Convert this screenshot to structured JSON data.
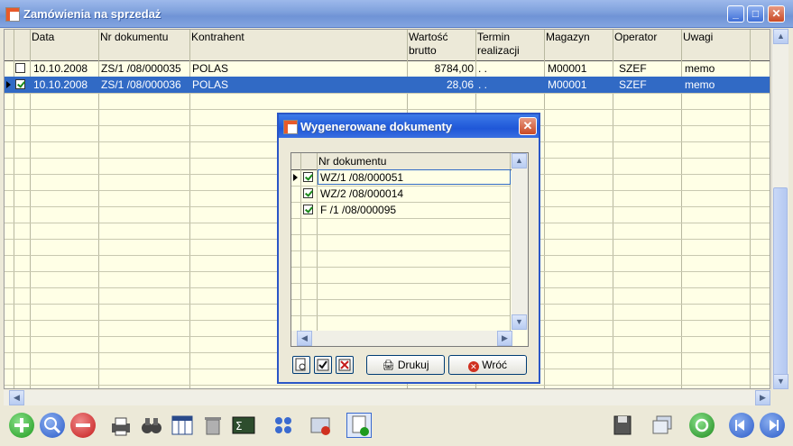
{
  "window": {
    "title": "Zamówienia na sprzedaż",
    "minimize": "_",
    "maximize": "□",
    "close": "✕"
  },
  "columns": {
    "data": "Data",
    "nr_dokumentu": "Nr dokumentu",
    "kontrahent": "Kontrahent",
    "wartosc_1": "Wartość",
    "wartosc_2": "brutto",
    "termin_1": "Termin",
    "termin_2": "realizacji",
    "magazyn": "Magazyn",
    "operator": "Operator",
    "uwagi": "Uwagi"
  },
  "rows": [
    {
      "checked": false,
      "selected": false,
      "data": "10.10.2008",
      "nr": "ZS/1  /08/000035",
      "kontrahent": "POLAS",
      "wartosc": "8784,00",
      "termin": ". .",
      "magazyn": "M00001",
      "operator": "SZEF",
      "uwagi": "memo"
    },
    {
      "checked": true,
      "selected": true,
      "data": "10.10.2008",
      "nr": "ZS/1  /08/000036",
      "kontrahent": "POLAS",
      "wartosc": "28,06",
      "termin": ". .",
      "magazyn": "M00001",
      "operator": "SZEF",
      "uwagi": "memo"
    }
  ],
  "dialog": {
    "title": "Wygenerowane dokumenty",
    "close": "✕",
    "column": "Nr dokumentu",
    "rows": [
      {
        "checked": true,
        "nr": "WZ/1  /08/000051"
      },
      {
        "checked": true,
        "nr": "WZ/2  /08/000014"
      },
      {
        "checked": true,
        "nr": "F /1  /08/000095"
      }
    ],
    "print_label": "Drukuj",
    "back_label": "Wróć"
  },
  "colors": {
    "selection": "#316AC5",
    "grid_bg": "#FFFFE6",
    "face": "#ECE9D8",
    "title_active": "#1F57D8"
  }
}
